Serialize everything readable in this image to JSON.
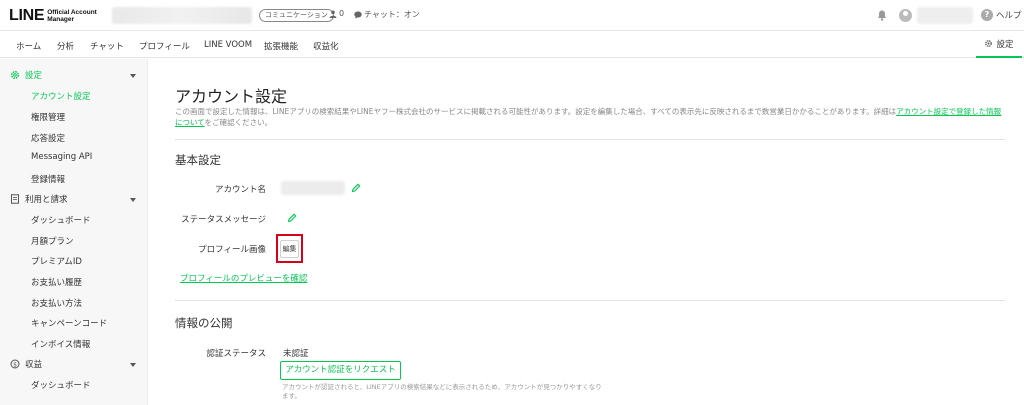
{
  "colors": {
    "brand_green": "#06c755",
    "highlight_red": "#d9001b"
  },
  "header": {
    "logo_main": "LINE",
    "logo_sub_line1": "Official Account",
    "logo_sub_line2": "Manager",
    "plan_badge": "コミュニケーション",
    "follower_count": "0",
    "chat_status": "チャット：オン",
    "help_label": "ヘルプ"
  },
  "nav": {
    "items": [
      "ホーム",
      "分析",
      "チャット",
      "プロフィール",
      "LINE VOOM",
      "拡張機能",
      "収益化"
    ],
    "settings_label": "設定"
  },
  "sidebar": {
    "sections": [
      {
        "label": "設定",
        "icon": "gear-icon",
        "items": [
          "アカウント設定",
          "権限管理",
          "応答設定",
          "Messaging API",
          "登録情報"
        ]
      },
      {
        "label": "利用と請求",
        "icon": "receipt-icon",
        "items": [
          "ダッシュボード",
          "月額プラン",
          "プレミアムID",
          "お支払い履歴",
          "お支払い方法",
          "キャンペーンコード",
          "インボイス情報"
        ]
      },
      {
        "label": "収益",
        "icon": "coin-icon",
        "items": [
          "ダッシュボード"
        ]
      }
    ],
    "active_item": "アカウント設定"
  },
  "main": {
    "title": "アカウント設定",
    "description_pre": "この画面で設定した情報は、LINEアプリの検索結果やLINEヤフー株式会社のサービスに掲載される可能性があります。設定を編集した場合、すべての表示先に反映されるまで数営業日かかることがあります。詳細は",
    "description_link": "アカウント設定で登録した情報について",
    "description_post": "をご確認ください。",
    "basic": {
      "heading": "基本設定",
      "account_name_label": "アカウント名",
      "status_message_label": "ステータスメッセージ",
      "profile_image_label": "プロフィール画像",
      "edit_button": "編集",
      "preview_link": "プロフィールのプレビューを確認"
    },
    "disclosure": {
      "heading": "情報の公開",
      "verify_status_label": "認証ステータス",
      "verify_status_value": "未認証",
      "verify_button": "アカウント認証をリクエスト",
      "verify_note": "アカウントが認証されると、LINEアプリの検索結果などに表示されるため、アカウントが見つかりやすくなります。"
    }
  }
}
